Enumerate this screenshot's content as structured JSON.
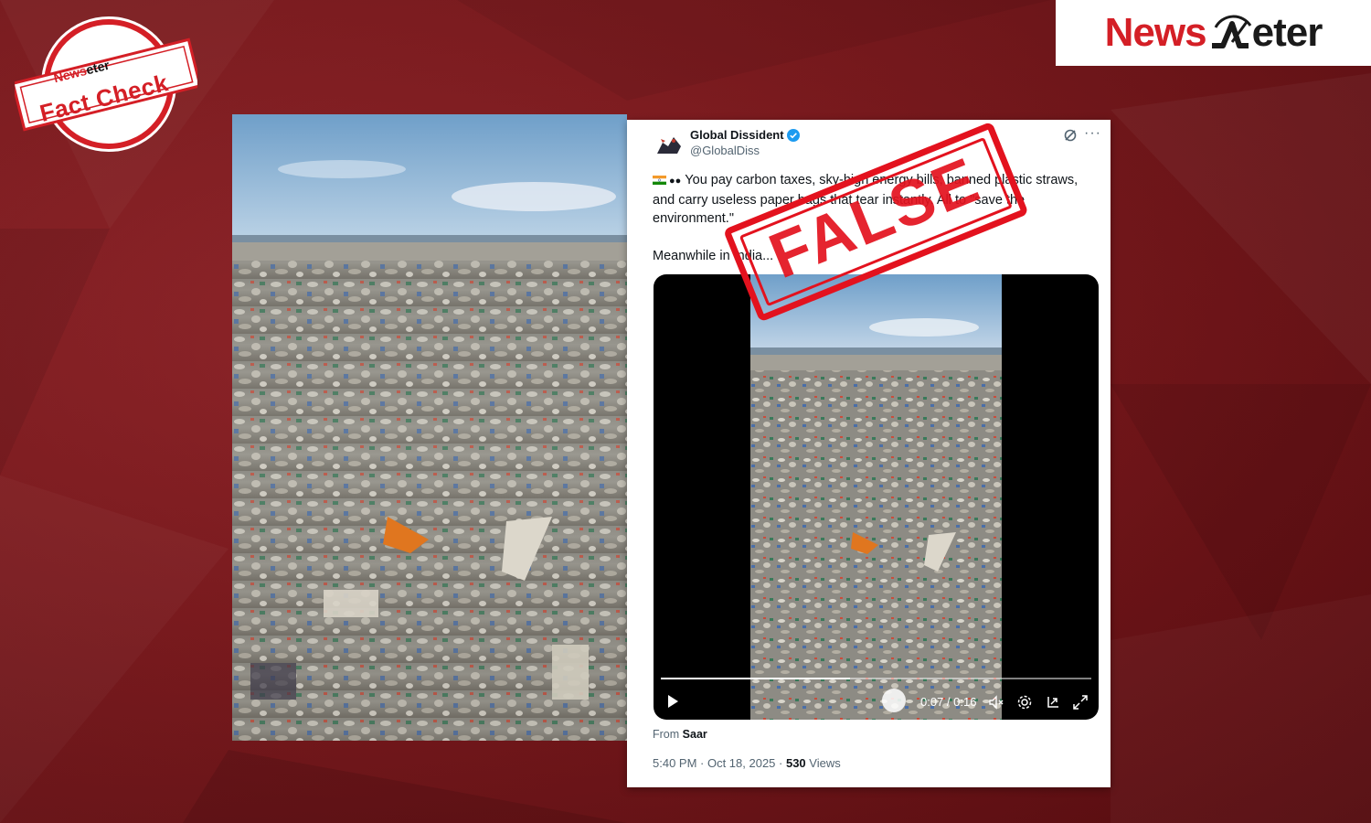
{
  "badge": {
    "line1a": "News",
    "line1b": "eter",
    "line2": "Fact Check"
  },
  "logo": {
    "news": "News",
    "meter": "eter"
  },
  "tweet": {
    "author_name": "Global Dissident",
    "author_handle": "@GlobalDiss",
    "text_line1": "You pay carbon taxes, sky-high energy bills, banned plastic straws, and carry useless paper bags that tear instantly. All to \"save the environment.\"",
    "text_line2": "Meanwhile in India...",
    "video": {
      "time_current": "0:07",
      "time_total": "0:16",
      "progress": 0.44
    },
    "from_label": "From",
    "from_source": "Saar",
    "time": "5:40 PM · Oct 18, 2025 · ",
    "views_count": "530",
    "views_label": " Views"
  },
  "stamp": {
    "text": "FALSE"
  },
  "colors": {
    "background": "#7a1519",
    "accent": "#d41f26",
    "stamp": "#e3121e"
  }
}
